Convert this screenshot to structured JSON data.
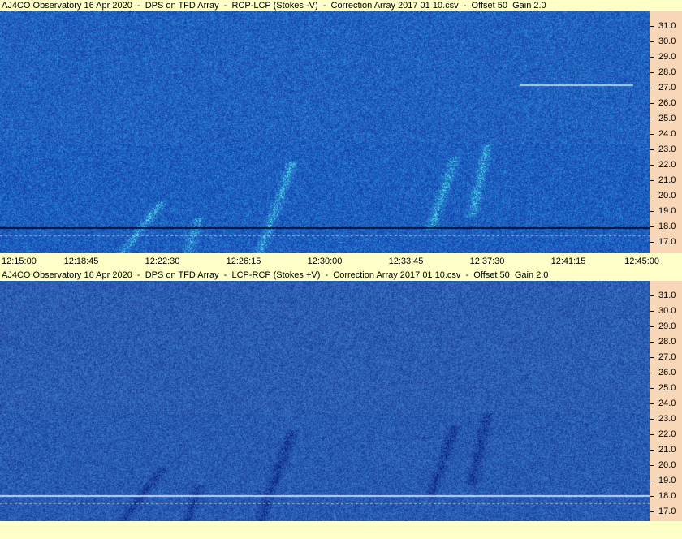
{
  "panels": [
    {
      "title": "AJ4CO Observatory 16 Apr 2020  -  DPS on TFD Array  -  RCP-LCP (Stokes -V)  -  Correction Array 2017 01 10.csv  -  Offset 50  Gain 2.0",
      "polarity": "bright"
    },
    {
      "title": "AJ4CO Observatory 16 Apr 2020  -  DPS on TFD Array  -  LCP-RCP (Stokes +V)  -  Correction Array 2017 01 10.csv  -  Offset 50  Gain 2.0",
      "polarity": "dark"
    }
  ],
  "freq_labels": [
    "31.0",
    "30.0",
    "29.0",
    "28.0",
    "27.0",
    "26.0",
    "25.0",
    "24.0",
    "23.0",
    "22.0",
    "21.0",
    "20.0",
    "19.0",
    "18.0",
    "17.0"
  ],
  "time_labels": [
    "12:15:00",
    "12:18:45",
    "12:22:30",
    "12:26:15",
    "12:30:00",
    "12:33:45",
    "12:37:30",
    "12:41:15",
    "12:45:00"
  ],
  "colors": {
    "background": "#ffffc8",
    "freq_axis": "#f7d7b8",
    "spectrogram_base": "#2a55c8"
  }
}
